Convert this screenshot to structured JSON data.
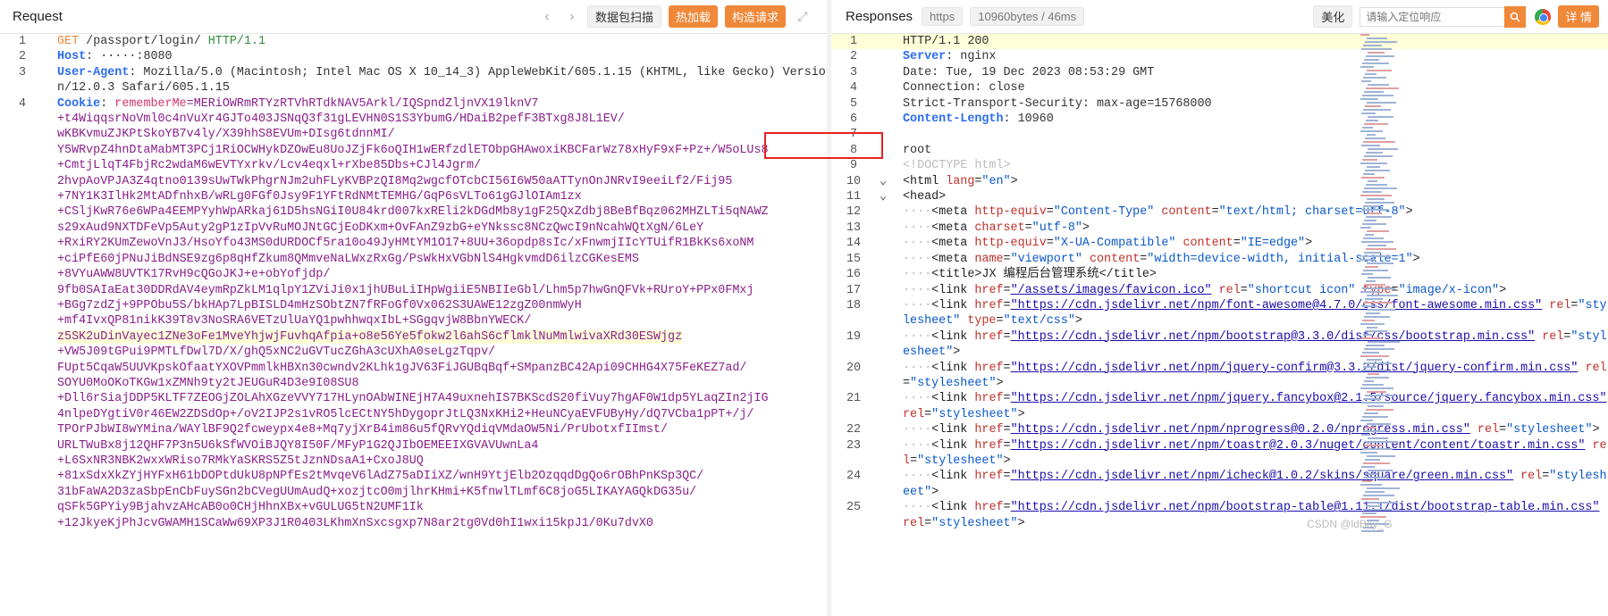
{
  "left": {
    "title": "Request",
    "buttons": {
      "scan": "数据包扫描",
      "hotload": "热加载",
      "build": "构造请求"
    },
    "lines": [
      {
        "n": "1",
        "parts": [
          {
            "c": "kw-method",
            "t": "GET "
          },
          {
            "c": "hval",
            "t": "/passport/login/ "
          },
          {
            "c": "kw-proto",
            "t": "HTTP/1.1"
          }
        ]
      },
      {
        "n": "2",
        "parts": [
          {
            "c": "hkey",
            "t": "Host"
          },
          {
            "c": "hval",
            "t": ": ·····:8080"
          }
        ]
      },
      {
        "n": "3",
        "parts": [
          {
            "c": "hkey",
            "t": "User-Agent"
          },
          {
            "c": "hval",
            "t": ": Mozilla/5.0 (Macintosh; Intel Mac OS X 10_14_3) AppleWebKit/605.1.15 (KHTML, like Gecko) Version/12.0.3 Safari/605.1.15"
          }
        ]
      },
      {
        "n": "4",
        "parts": [
          {
            "c": "hkey",
            "t": "Cookie"
          },
          {
            "c": "hval",
            "t": ": "
          },
          {
            "c": "ckn",
            "t": "rememberMe"
          },
          {
            "c": "ck",
            "t": "=MERiOWRmRTYzRTVhRTdkNAV5Arkl/IQSpndZljnVX19lknV7\n+t4WiqqsrNoVml0c4nVuXr4GJTo403JSNqQ3f31gLEVHN0S1S3YbumG/HDaiB2pefF3BTxg8J8L1EV/\nwKBKvmuZJKPtSkoYB7v4ly/X39hhS8EVUm+DIsg6tdnnMI/\nY5WRvpZ4hnDtaMabMT3PCj1RiOCWHykDZOwEu8UoJZjFk6oQIH1wERfzdlETObpGHAwoxiKBCFarWz78xHyF9xF+Pz+/W5oLUs8\n+CmtjLlqT4FbjRc2wdaM6wEVTYxrkv/Lcv4eqxl+rXbe85Dbs+CJl4Jgrm/\n2hvpAoVPJA3Z4qtno0139sUwTWkPhgrNJm2uhFLyKVBPzQI8Mq2wgcfOTcbCI56I6W50aATTynOnJNRvI9eeiLf2/Fij95\n+7NY1K3IlHk2MtADfnhxB/wRLg0FGf0Jsy9F1YFtRdNMtTEMHG/GqP6sVLTo61gGJlOIAm1zx\n+CSljKwR76e6WPa4EEMPYyhWpARkaj61D5hsNGiI0U84krd007kxREli2kDGdMb8y1gF25QxZdbj8BeBfBqz062MHZLTi5qNAWZ\ns29xAud9NXTDFeVp5Auty2gP1zIpVvRuMOJNtGCjEoDKxm+OvFAnZ9zbG+eYNkssc8NCzQwcI9nNcahWQtXgN/6LeY\n+RxiRY2KUmZewoVnJ3/HsoYfo43MS0dURDOCf5ra10o49JyHMtYM1O17+8UU+36opdp8sIc/xFnwmjIIcYTUifR1BkKs6xoNM\n+ciPfE60jPNuJiBdNSE9zg6p8qHfZkum8QMmveNaLWxzRxGg/PsWkHxVGbNlS4HgkvmdD6ilzCGKesEMS\n+8VYuAWW8UVTK17RvH9cQGoJKJ+e+obYofjdp/\n9fb0SAIaEat30DDRdAV4eymRpZkLM1qlpY1ZViJi0x1jhUBuLiIHpWgiiE5NBIIeGbl/Lhm5p7hwGnQFVk+RUroY+PPx0FMxj\n+BGg7zdZj+9PPObu5S/bkHAp7LpBISLD4mHzSObtZN7fRFoGf0Vx062S3UAWE12zgZ00nmWyH\n+mf4IvxQP81nikK39T8v3NoSRA6VETzUlUaYQ1pwhhwqxIbL+SGgqvjW8BbnYWECK/"
          },
          {
            "c": "ck hl",
            "t": "\nz5SK2uDinVayec1ZNe3oFe1MveYhjwjFuvhqAfpia+o8e56Ye5fokw2l6ahS6cflmklNuMmlwivaXRd30ESWjgz"
          },
          {
            "c": "ck",
            "t": "\n+VW5J09tGPui9PMTLfDwl7D/X/ghQ5xNC2uGVTucZGhA3cUXhA0seLgzTqpv/\nFUpt5CqaW5UUVKpskOfaatYXOVPmmlkHBXn30cwndv2KLhk1gJV63FiJGUBqBqf+SMpanzBC42Api09CHHG4X75FeKEZ7ad/\nSOYU0MoOKoTKGw1xZMNh9ty2tJEUGuR4D3e9I08SU8\n+Dll6rSiajDDP5KLTF7ZEOGjZOLAhXGzeVVY717HLynOAbWINEjH7A49uxnehIS7BKScdS20fiVuy7hgAF0W1dp5YLaqZIn2jIG\n4nlpeDYgtiV0r46EW2ZDSdOp+/oV2IJP2s1vRO5lcECtNY5hDygoprJtLQ3NxKHi2+HeuNCyaEVFUByHy/dQ7VCba1pPT+/j/\nTPOrPJbWI8wYMina/WAYlBF9Q2fcweypx4e8+Mq7yjXrB4im86u5fQRvYQdiqVMdaOW5Ni/PrUbotxfIImst/\nURLTWuBx8j12QHF7P3n5U6kSfWVOiBJQY8I50F/MFyP1G2QJIbOEMEEIXGVAVUwnLa4\n+L6SxNR3NBK2wxxWRiso7RMkYaSKRS5Z5tJznNDsaA1+CxoJ8UQ\n+81xSdxXkZYjHYFxH61bDOPtdUkU8pNPfEs2tMvqeV6lAdZ75aDIiXZ/wnH9YtjElb2OzqqdDgQo6rOBhPnKSp3QC/\n31bFaWA2D3zaSbpEnCbFuySGn2bCVegUUmAudQ+xozjtcO0mjlhrKHmi+K5fnwlTLmf6C8joG5LIKAYAGQkDG35u/\nqSFk5GPYiy9BjahvzAHcAB0o0CHjHhnXBx+vGULUG5tN2UMF1Ik\n+12JkyeKjPhJcvGWAMH1SCaWw69XP3J1R0403LKhmXnSxcsgxp7N8ar2tg0Vd0hI1wxi15kpJ1/0Ku7dvX0"
          }
        ]
      }
    ]
  },
  "right": {
    "title": "Responses",
    "tags": {
      "protocol": "https",
      "size": "10960bytes / 46ms"
    },
    "buttons": {
      "beautify": "美化",
      "detail": "详 情"
    },
    "search_placeholder": "请输入定位响应",
    "watermark": "CSDN @ldBoy_G",
    "lines": [
      {
        "n": "1",
        "fold": "",
        "parts": [
          {
            "c": "hval",
            "t": "HTTP/1.1 200"
          }
        ],
        "hl": true
      },
      {
        "n": "2",
        "fold": "",
        "parts": [
          {
            "c": "hkey",
            "t": "Server"
          },
          {
            "c": "hval",
            "t": ": nginx"
          }
        ]
      },
      {
        "n": "3",
        "fold": "",
        "parts": [
          {
            "c": "hval",
            "t": "Date: Tue, 19 Dec 2023 08:53:29 GMT"
          }
        ]
      },
      {
        "n": "4",
        "fold": "",
        "parts": [
          {
            "c": "hval",
            "t": "Connection: close"
          }
        ]
      },
      {
        "n": "5",
        "fold": "",
        "parts": [
          {
            "c": "hval",
            "t": "Strict-Transport-Security: max-age=15768000"
          }
        ]
      },
      {
        "n": "6",
        "fold": "",
        "parts": [
          {
            "c": "hkey",
            "t": "Content-Length"
          },
          {
            "c": "hval",
            "t": ": 10960"
          }
        ]
      },
      {
        "n": "7",
        "fold": "",
        "parts": [
          {
            "c": "hval",
            "t": ""
          }
        ]
      },
      {
        "n": "8",
        "fold": "",
        "parts": [
          {
            "c": "hval",
            "t": "root"
          }
        ]
      },
      {
        "n": "9",
        "fold": "",
        "parts": [
          {
            "c": "guide",
            "t": "<!DOCTYPE html>"
          }
        ]
      },
      {
        "n": "10",
        "fold": "⌄",
        "parts": [
          {
            "c": "tagc",
            "t": "<html "
          },
          {
            "c": "attr",
            "t": "lang"
          },
          {
            "c": "tagc",
            "t": "="
          },
          {
            "c": "aval",
            "t": "\"en\""
          },
          {
            "c": "tagc",
            "t": ">"
          }
        ]
      },
      {
        "n": "11",
        "fold": "⌄",
        "parts": [
          {
            "c": "tagc",
            "t": "<head>"
          }
        ]
      },
      {
        "n": "12",
        "fold": "",
        "parts": [
          {
            "c": "guide",
            "t": "····"
          },
          {
            "c": "tagc",
            "t": "<meta "
          },
          {
            "c": "attr",
            "t": "http-equiv"
          },
          {
            "c": "tagc",
            "t": "="
          },
          {
            "c": "aval",
            "t": "\"Content-Type\" "
          },
          {
            "c": "attr",
            "t": "content"
          },
          {
            "c": "tagc",
            "t": "="
          },
          {
            "c": "aval",
            "t": "\"text/html; charset=utf-8\""
          },
          {
            "c": "tagc",
            "t": ">"
          }
        ]
      },
      {
        "n": "13",
        "fold": "",
        "parts": [
          {
            "c": "guide",
            "t": "····"
          },
          {
            "c": "tagc",
            "t": "<meta "
          },
          {
            "c": "attr",
            "t": "charset"
          },
          {
            "c": "tagc",
            "t": "="
          },
          {
            "c": "aval",
            "t": "\"utf-8\""
          },
          {
            "c": "tagc",
            "t": ">"
          }
        ]
      },
      {
        "n": "14",
        "fold": "",
        "parts": [
          {
            "c": "guide",
            "t": "····"
          },
          {
            "c": "tagc",
            "t": "<meta "
          },
          {
            "c": "attr",
            "t": "http-equiv"
          },
          {
            "c": "tagc",
            "t": "="
          },
          {
            "c": "aval",
            "t": "\"X-UA-Compatible\" "
          },
          {
            "c": "attr",
            "t": "content"
          },
          {
            "c": "tagc",
            "t": "="
          },
          {
            "c": "aval",
            "t": "\"IE=edge\""
          },
          {
            "c": "tagc",
            "t": ">"
          }
        ]
      },
      {
        "n": "15",
        "fold": "",
        "parts": [
          {
            "c": "guide",
            "t": "····"
          },
          {
            "c": "tagc",
            "t": "<meta "
          },
          {
            "c": "attr",
            "t": "name"
          },
          {
            "c": "tagc",
            "t": "="
          },
          {
            "c": "aval",
            "t": "\"viewport\" "
          },
          {
            "c": "attr",
            "t": "content"
          },
          {
            "c": "tagc",
            "t": "="
          },
          {
            "c": "aval",
            "t": "\"width=device-width, initial-scale=1\""
          },
          {
            "c": "tagc",
            "t": ">"
          }
        ]
      },
      {
        "n": "16",
        "fold": "",
        "parts": [
          {
            "c": "guide",
            "t": "····"
          },
          {
            "c": "tagc",
            "t": "<title>JX 编程后台管理系统</title>"
          }
        ]
      },
      {
        "n": "17",
        "fold": "",
        "parts": [
          {
            "c": "guide",
            "t": "····"
          },
          {
            "c": "tagc",
            "t": "<link "
          },
          {
            "c": "attr",
            "t": "href"
          },
          {
            "c": "tagc",
            "t": "="
          },
          {
            "c": "url",
            "t": "\"/assets/images/favicon.ico\""
          },
          {
            "c": "tagc",
            "t": " "
          },
          {
            "c": "attr",
            "t": "rel"
          },
          {
            "c": "tagc",
            "t": "="
          },
          {
            "c": "aval",
            "t": "\"shortcut icon\" "
          },
          {
            "c": "attr",
            "t": "type"
          },
          {
            "c": "tagc",
            "t": "="
          },
          {
            "c": "aval",
            "t": "\"image/x-icon\""
          },
          {
            "c": "tagc",
            "t": ">"
          }
        ]
      },
      {
        "n": "18",
        "fold": "",
        "parts": [
          {
            "c": "guide",
            "t": "····"
          },
          {
            "c": "tagc",
            "t": "<link "
          },
          {
            "c": "attr",
            "t": "href"
          },
          {
            "c": "tagc",
            "t": "="
          },
          {
            "c": "url",
            "t": "\"https://cdn.jsdelivr.net/npm/font-awesome@4.7.0/css/font-awesome.min.css\""
          },
          {
            "c": "tagc",
            "t": " "
          },
          {
            "c": "attr",
            "t": "rel"
          },
          {
            "c": "tagc",
            "t": "="
          },
          {
            "c": "aval",
            "t": "\"stylesheet\" "
          },
          {
            "c": "attr",
            "t": "type"
          },
          {
            "c": "tagc",
            "t": "="
          },
          {
            "c": "aval",
            "t": "\"text/css\""
          },
          {
            "c": "tagc",
            "t": ">"
          }
        ]
      },
      {
        "n": "19",
        "fold": "",
        "parts": [
          {
            "c": "guide",
            "t": "····"
          },
          {
            "c": "tagc",
            "t": "<link "
          },
          {
            "c": "attr",
            "t": "href"
          },
          {
            "c": "tagc",
            "t": "="
          },
          {
            "c": "url",
            "t": "\"https://cdn.jsdelivr.net/npm/bootstrap@3.3.0/dist/css/bootstrap.min.css\""
          },
          {
            "c": "tagc",
            "t": " "
          },
          {
            "c": "attr",
            "t": "rel"
          },
          {
            "c": "tagc",
            "t": "="
          },
          {
            "c": "aval",
            "t": "\"stylesheet\""
          },
          {
            "c": "tagc",
            "t": ">"
          }
        ]
      },
      {
        "n": "20",
        "fold": "",
        "parts": [
          {
            "c": "guide",
            "t": "····"
          },
          {
            "c": "tagc",
            "t": "<link "
          },
          {
            "c": "attr",
            "t": "href"
          },
          {
            "c": "tagc",
            "t": "="
          },
          {
            "c": "url",
            "t": "\"https://cdn.jsdelivr.net/npm/jquery-confirm@3.3.2/dist/jquery-confirm.min.css\""
          },
          {
            "c": "tagc",
            "t": " "
          },
          {
            "c": "attr",
            "t": "rel"
          },
          {
            "c": "tagc",
            "t": "="
          },
          {
            "c": "aval",
            "t": "\"stylesheet\""
          },
          {
            "c": "tagc",
            "t": ">"
          }
        ]
      },
      {
        "n": "21",
        "fold": "",
        "parts": [
          {
            "c": "guide",
            "t": "····"
          },
          {
            "c": "tagc",
            "t": "<link "
          },
          {
            "c": "attr",
            "t": "href"
          },
          {
            "c": "tagc",
            "t": "="
          },
          {
            "c": "url",
            "t": "\"https://cdn.jsdelivr.net/npm/jquery.fancybox@2.1.5/source/jquery.fancybox.min.css\""
          },
          {
            "c": "tagc",
            "t": " "
          },
          {
            "c": "attr",
            "t": "rel"
          },
          {
            "c": "tagc",
            "t": "="
          },
          {
            "c": "aval",
            "t": "\"stylesheet\""
          },
          {
            "c": "tagc",
            "t": ">"
          }
        ]
      },
      {
        "n": "22",
        "fold": "",
        "parts": [
          {
            "c": "guide",
            "t": "····"
          },
          {
            "c": "tagc",
            "t": "<link "
          },
          {
            "c": "attr",
            "t": "href"
          },
          {
            "c": "tagc",
            "t": "="
          },
          {
            "c": "url",
            "t": "\"https://cdn.jsdelivr.net/npm/nprogress@0.2.0/nprogress.min.css\""
          },
          {
            "c": "tagc",
            "t": " "
          },
          {
            "c": "attr",
            "t": "rel"
          },
          {
            "c": "tagc",
            "t": "="
          },
          {
            "c": "aval",
            "t": "\"stylesheet\""
          },
          {
            "c": "tagc",
            "t": ">"
          }
        ]
      },
      {
        "n": "23",
        "fold": "",
        "parts": [
          {
            "c": "guide",
            "t": "····"
          },
          {
            "c": "tagc",
            "t": "<link "
          },
          {
            "c": "attr",
            "t": "href"
          },
          {
            "c": "tagc",
            "t": "="
          },
          {
            "c": "url",
            "t": "\"https://cdn.jsdelivr.net/npm/toastr@2.0.3/nuget/content/content/toastr.min.css\""
          },
          {
            "c": "tagc",
            "t": " "
          },
          {
            "c": "attr",
            "t": "rel"
          },
          {
            "c": "tagc",
            "t": "="
          },
          {
            "c": "aval",
            "t": "\"stylesheet\""
          },
          {
            "c": "tagc",
            "t": ">"
          }
        ]
      },
      {
        "n": "24",
        "fold": "",
        "parts": [
          {
            "c": "guide",
            "t": "····"
          },
          {
            "c": "tagc",
            "t": "<link "
          },
          {
            "c": "attr",
            "t": "href"
          },
          {
            "c": "tagc",
            "t": "="
          },
          {
            "c": "url",
            "t": "\"https://cdn.jsdelivr.net/npm/icheck@1.0.2/skins/square/green.min.css\""
          },
          {
            "c": "tagc",
            "t": " "
          },
          {
            "c": "attr",
            "t": "rel"
          },
          {
            "c": "tagc",
            "t": "="
          },
          {
            "c": "aval",
            "t": "\"stylesheet\""
          },
          {
            "c": "tagc",
            "t": ">"
          }
        ]
      },
      {
        "n": "25",
        "fold": "",
        "parts": [
          {
            "c": "guide",
            "t": "····"
          },
          {
            "c": "tagc",
            "t": "<link "
          },
          {
            "c": "attr",
            "t": "href"
          },
          {
            "c": "tagc",
            "t": "="
          },
          {
            "c": "url",
            "t": "\"https://cdn.jsdelivr.net/npm/bootstrap-table@1.11.1/dist/bootstrap-table.min.css\""
          },
          {
            "c": "tagc",
            "t": " "
          },
          {
            "c": "attr",
            "t": "rel"
          },
          {
            "c": "tagc",
            "t": "="
          },
          {
            "c": "aval",
            "t": "\"stylesheet\""
          },
          {
            "c": "tagc",
            "t": ">"
          }
        ]
      }
    ]
  },
  "colors": {
    "accent": "#f0883a",
    "highlight_box": "#e52323",
    "line_highlight": "#fefed8"
  },
  "icons": {
    "prev": "chevron-left-icon",
    "next": "chevron-right-icon",
    "expand": "expand-icon",
    "search": "search-icon",
    "browser": "chrome-icon"
  }
}
